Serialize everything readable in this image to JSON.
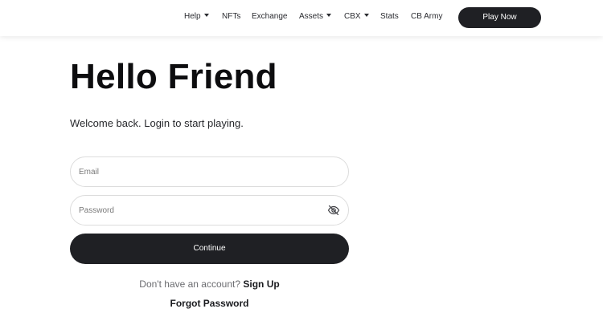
{
  "nav": {
    "items": [
      {
        "label": "Help",
        "has_dropdown": true
      },
      {
        "label": "NFTs",
        "has_dropdown": false
      },
      {
        "label": "Exchange",
        "has_dropdown": false
      },
      {
        "label": "Assets",
        "has_dropdown": true
      },
      {
        "label": "CBX",
        "has_dropdown": true
      },
      {
        "label": "Stats",
        "has_dropdown": false
      },
      {
        "label": "CB Army",
        "has_dropdown": false
      }
    ],
    "play_button_label": "Play Now"
  },
  "login": {
    "headline": "Hello Friend",
    "subtitle": "Welcome back. Login to start playing.",
    "email_placeholder": "Email",
    "email_value": "",
    "password_placeholder": "Password",
    "password_value": "",
    "password_toggle_icon": "eye-slash-icon",
    "continue_label": "Continue",
    "no_account_text": "Don't have an account?",
    "signup_label": "Sign Up",
    "forgot_label": "Forgot Password"
  },
  "colors": {
    "primary_dark": "#1f2024",
    "background": "#ffffff",
    "field_border": "#dcdcdc",
    "muted_text": "#6b6c70"
  }
}
